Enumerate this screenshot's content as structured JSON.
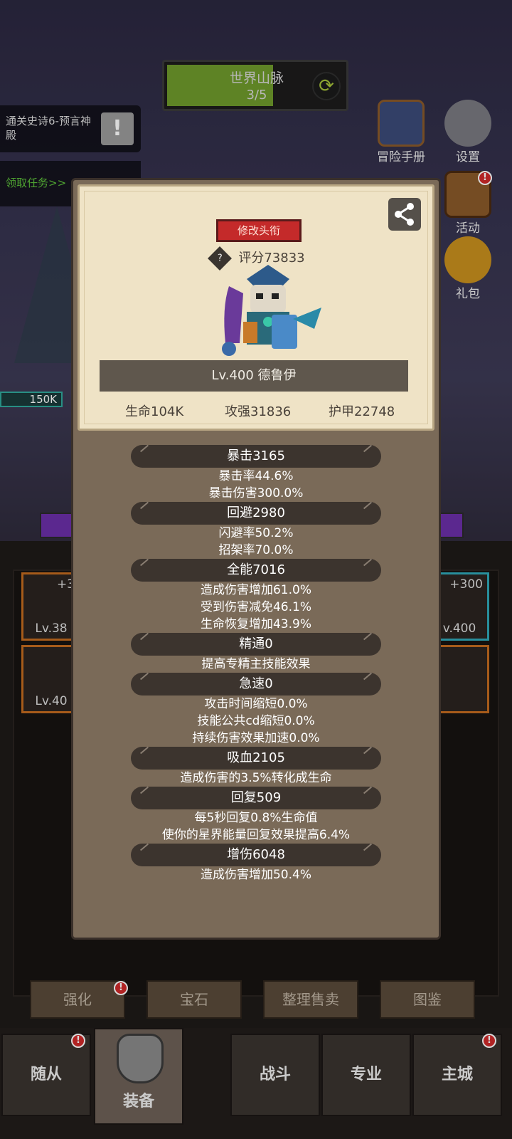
{
  "map": {
    "title": "世界山脉",
    "progress": "3/5",
    "progress_fraction": 0.6
  },
  "quest": {
    "text": "通关史诗6-预言神殿",
    "claim": "领取任务>>"
  },
  "side_icons": [
    {
      "label": "冒险手册",
      "icon": "book-icon"
    },
    {
      "label": "设置",
      "icon": "gear-icon"
    },
    {
      "label": "活动",
      "icon": "scroll-icon"
    },
    {
      "label": "礼包",
      "icon": "gift-icon"
    }
  ],
  "hp_badge": "150K",
  "slots": {
    "left_top": {
      "plus": "+3",
      "level": "Lv.38"
    },
    "left_bottom": {
      "level": "Lv.40"
    },
    "right_top": {
      "plus": "+300",
      "level": "v.400"
    }
  },
  "func_buttons": [
    "强化",
    "宝石",
    "整理售卖",
    "图鉴"
  ],
  "nav_tabs": [
    "随从",
    "装备",
    "战斗",
    "专业",
    "主城"
  ],
  "modal": {
    "title_button": "修改头衔",
    "score_help": "?",
    "score": "评分73833",
    "hero_name": "Lv.400 德鲁伊",
    "stats": {
      "hp": "生命104K",
      "attack": "攻强31836",
      "armor": "护甲22748"
    },
    "attributes": [
      {
        "name": "暴击3165",
        "details": [
          "暴击率44.6%",
          "暴击伤害300.0%"
        ]
      },
      {
        "name": "回避2980",
        "details": [
          "闪避率50.2%",
          "招架率70.0%"
        ]
      },
      {
        "name": "全能7016",
        "details": [
          "造成伤害增加61.0%",
          "受到伤害减免46.1%",
          "生命恢复增加43.9%"
        ]
      },
      {
        "name": "精通0",
        "details": [
          "提高专精主技能效果"
        ]
      },
      {
        "name": "急速0",
        "details": [
          "攻击时间缩短0.0%",
          "技能公共cd缩短0.0%",
          "持续伤害效果加速0.0%"
        ]
      },
      {
        "name": "吸血2105",
        "details": [
          "造成伤害的3.5%转化成生命"
        ]
      },
      {
        "name": "回复509",
        "details": [
          "每5秒回复0.8%生命值",
          "使你的星界能量回复效果提高6.4%"
        ]
      },
      {
        "name": "增伤6048",
        "details": [
          "造成伤害增加50.4%"
        ]
      }
    ]
  },
  "colors": {
    "accent_red": "#c42a2a",
    "panel": "#7a6a58",
    "parchment": "#efe3c6"
  }
}
